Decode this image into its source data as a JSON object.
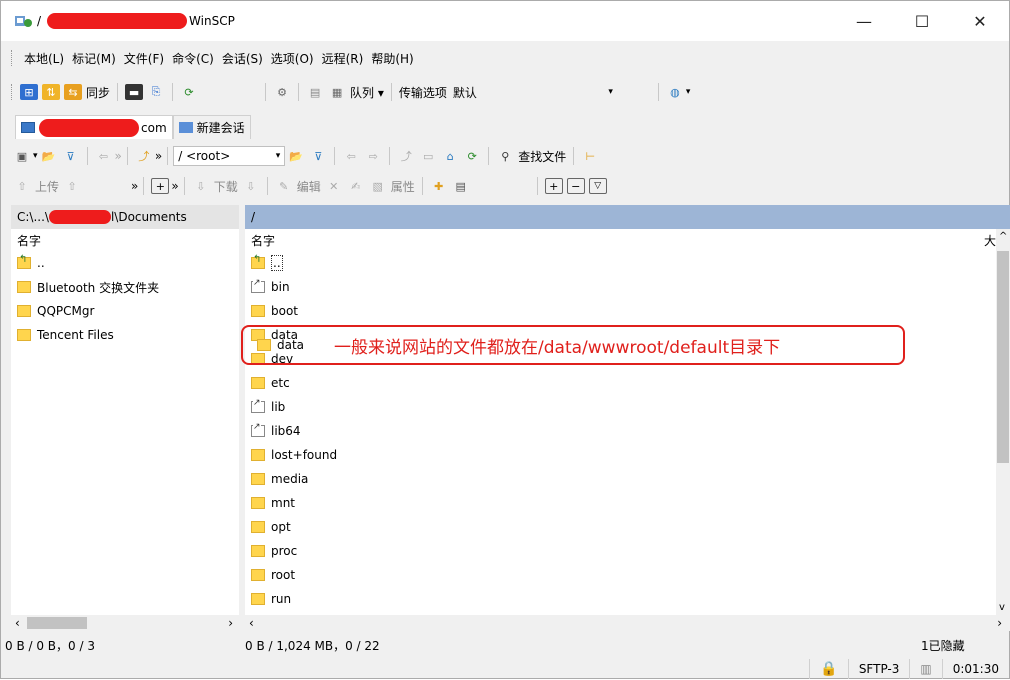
{
  "window": {
    "title_prefix": "/",
    "title_app": "WinSCP",
    "minimize": "—",
    "maximize": "☐",
    "close": "✕"
  },
  "menu": [
    "本地(L)",
    "标记(M)",
    "文件(F)",
    "命令(C)",
    "会话(S)",
    "选项(O)",
    "远程(R)",
    "帮助(H)"
  ],
  "toolbar1": {
    "sync_label": "同步",
    "queue_label": "队列 ▾",
    "transfer_label": "传输选项",
    "transfer_value": "默认"
  },
  "tabs": {
    "session_suffix": "com",
    "new_session": "新建会话"
  },
  "remote_toolbar": {
    "path_select": "/ <root>",
    "find_files": "查找文件"
  },
  "toolbar3": {
    "upload": "上传",
    "download": "下载",
    "edit": "编辑",
    "properties": "属性"
  },
  "left_panel": {
    "path_prefix": "C:\\...\\",
    "path_suffix": "l\\Documents",
    "col_name": "名字",
    "rows": [
      "..",
      "Bluetooth 交换文件夹",
      "QQPCMgr",
      "Tencent Files"
    ],
    "status": "0 B / 0 B，0 / 3"
  },
  "right_panel": {
    "path": "/",
    "col_name": "名字",
    "col_size": "大",
    "rows": [
      "..",
      "bin",
      "boot",
      "data",
      "dev",
      "etc",
      "lib",
      "lib64",
      "lost+found",
      "media",
      "mnt",
      "opt",
      "proc",
      "root",
      "run"
    ],
    "status": "0 B / 1,024 MB，0 / 22",
    "hidden": "1已隐藏"
  },
  "annotation": {
    "text": "一般来说网站的文件都放在/data/wwwroot/default目录下",
    "color": "#e0201c"
  },
  "bottom": {
    "protocol": "SFTP-3",
    "elapsed": "0:01:30"
  },
  "colors": {
    "path_highlight": "#9db5d6",
    "folder": "#ffd54d",
    "redaction": "#ee1c1c"
  }
}
